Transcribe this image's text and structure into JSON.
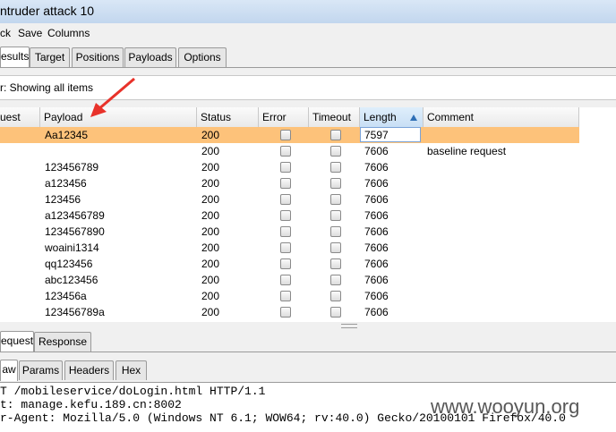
{
  "window": {
    "title": "ntruder attack 10"
  },
  "menu": [
    "ck",
    "Save",
    "Columns"
  ],
  "tabs": [
    "esults",
    "Target",
    "Positions",
    "Payloads",
    "Options"
  ],
  "filter": {
    "text": "r:  Showing all items"
  },
  "table": {
    "columns": [
      "uest",
      "Payload",
      "Status",
      "Error",
      "Timeout",
      "Length",
      "Comment"
    ],
    "sorted_column": "Length",
    "rows": [
      {
        "payload": "Aa12345",
        "status": "200",
        "length": "7597",
        "comment": "",
        "selected": true
      },
      {
        "payload": "",
        "status": "200",
        "length": "7606",
        "comment": "baseline request",
        "selected": false
      },
      {
        "payload": "123456789",
        "status": "200",
        "length": "7606",
        "comment": "",
        "selected": false
      },
      {
        "payload": "a123456",
        "status": "200",
        "length": "7606",
        "comment": "",
        "selected": false
      },
      {
        "payload": "123456",
        "status": "200",
        "length": "7606",
        "comment": "",
        "selected": false
      },
      {
        "payload": "a123456789",
        "status": "200",
        "length": "7606",
        "comment": "",
        "selected": false
      },
      {
        "payload": "1234567890",
        "status": "200",
        "length": "7606",
        "comment": "",
        "selected": false
      },
      {
        "payload": "woaini1314",
        "status": "200",
        "length": "7606",
        "comment": "",
        "selected": false
      },
      {
        "payload": "qq123456",
        "status": "200",
        "length": "7606",
        "comment": "",
        "selected": false
      },
      {
        "payload": "abc123456",
        "status": "200",
        "length": "7606",
        "comment": "",
        "selected": false
      },
      {
        "payload": "123456a",
        "status": "200",
        "length": "7606",
        "comment": "",
        "selected": false
      },
      {
        "payload": "123456789a",
        "status": "200",
        "length": "7606",
        "comment": "",
        "selected": false
      }
    ]
  },
  "req_tabs": [
    "equest",
    "Response"
  ],
  "view_tabs": [
    "aw",
    "Params",
    "Headers",
    "Hex"
  ],
  "raw_lines": [
    "T /mobileservice/doLogin.html HTTP/1.1",
    "t: manage.kefu.189.cn:8002",
    "r-Agent: Mozilla/5.0 (Windows NT 6.1; WOW64; rv:40.0) Gecko/20100101 Firefox/40.0"
  ],
  "watermark": "www.wooyun.org",
  "colors": {
    "selected_row": "#fdc27a",
    "annotation_arrow": "#e8322a"
  }
}
